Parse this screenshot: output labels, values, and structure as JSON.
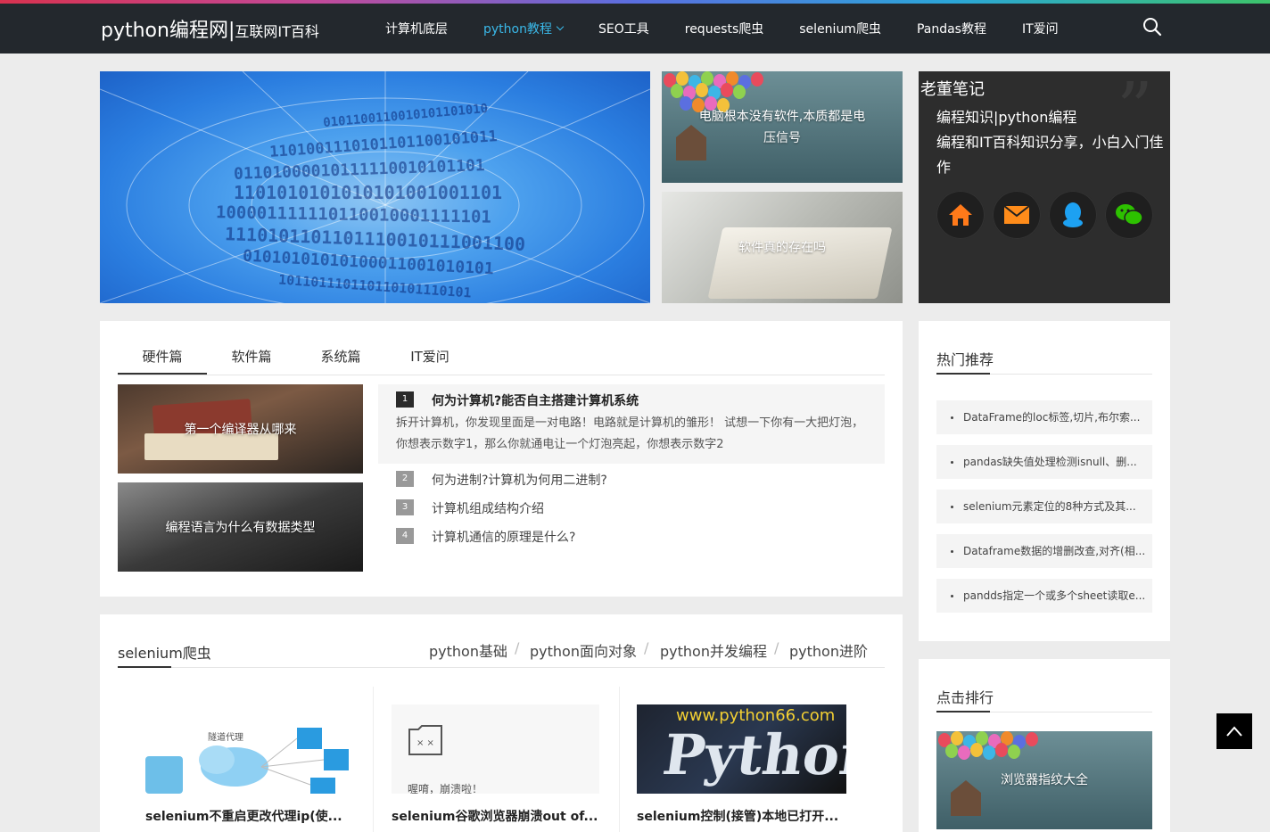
{
  "header": {
    "logo_main": "python编程网",
    "logo_sep": "|",
    "logo_sub": "互联网IT百科",
    "nav": [
      {
        "label": "计算机底层"
      },
      {
        "label": "python教程"
      },
      {
        "label": "SEO工具"
      },
      {
        "label": "requests爬虫"
      },
      {
        "label": "selenium爬虫"
      },
      {
        "label": "Pandas教程"
      },
      {
        "label": "IT爱问"
      }
    ],
    "search_icon": "search-icon"
  },
  "banner": {
    "binary_lines": [
      "0101100110010101101010",
      "1101001110101101100101011",
      "01101000010111110010101101",
      "1101010101010101001001101",
      "100001111110110010001111101",
      "1110101101101110010111001100",
      "01010101010100011001010101",
      "101101110110110101110101"
    ]
  },
  "side_thumbs": [
    {
      "title": "电脑根本没有软件,本质都是电压信号"
    },
    {
      "title": "软件真的存在吗"
    }
  ],
  "profile": {
    "name": "老董笔记",
    "subtitle": "编程知识|python编程",
    "desc": "编程和IT百科知识分享，小白入门佳作",
    "icons": [
      "home-icon",
      "mail-icon",
      "qq-icon",
      "wechat-icon"
    ]
  },
  "tabs": {
    "items": [
      "硬件篇",
      "软件篇",
      "系统篇",
      "IT爱问"
    ],
    "active": 0
  },
  "tab_images": [
    {
      "title": "第一个编译器从哪来"
    },
    {
      "title": "编程语言为什么有数据类型"
    }
  ],
  "article_list": {
    "featured": {
      "num": "1",
      "title": "何为计算机?能否自主搭建计算机系统",
      "desc": "拆开计算机，你发现里面是一对电路！电路就是计算机的雏形！ 试想一下你有一大把灯泡，你想表示数字1，那么你就通电让一个灯泡亮起，你想表示数字2"
    },
    "items": [
      {
        "num": "2",
        "title": "何为进制?计算机为何用二进制?"
      },
      {
        "num": "3",
        "title": "计算机组成结构介绍"
      },
      {
        "num": "4",
        "title": "计算机通信的原理是什么?"
      }
    ]
  },
  "hot": {
    "title": "热门推荐",
    "items": [
      "DataFrame的loc标签,切片,布尔索...",
      "pandas缺失值处理检测isnull、删...",
      "selenium元素定位的8种方式及其...",
      "Dataframe数据的增删改查,对齐(相...",
      "pandds指定一个或多个sheet读取e..."
    ]
  },
  "selenium_section": {
    "title": "selenium爬虫",
    "tabs": [
      "python基础",
      "python面向对象",
      "python并发编程",
      "python进阶"
    ],
    "separator": "/",
    "posts": [
      {
        "title": "selenium不重启更改代理ip(使...",
        "img_label": "隧道代理"
      },
      {
        "title": "selenium谷歌浏览器崩溃out of...",
        "img_label": "喔唷，崩溃啦！"
      },
      {
        "title": "selenium控制(接管)本地已打开...",
        "img_label": "www.python66.com",
        "img_word": "Python"
      }
    ]
  },
  "rank": {
    "title": "点击排行",
    "first": "浏览器指纹大全"
  },
  "colors": {
    "header_bg": "#23282d",
    "accent": "#3ab8e8",
    "profile_bg": "#2d2d2d",
    "icon_orange": "#ff7a1a",
    "icon_blue": "#1da1f2",
    "icon_green": "#2dc100"
  }
}
